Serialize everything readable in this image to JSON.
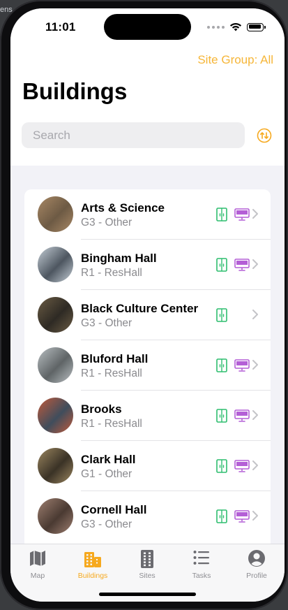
{
  "background_text": "ens",
  "status": {
    "time": "11:01"
  },
  "header": {
    "site_group": "Site Group: All",
    "title": "Buildings",
    "search_placeholder": "Search"
  },
  "buildings": [
    {
      "name": "Arts & Science",
      "sub": "G3 - Other",
      "has_door": true,
      "has_display": true,
      "photo": [
        "#6d5a44",
        "#a88865"
      ]
    },
    {
      "name": "Bingham Hall",
      "sub": "R1 - ResHall",
      "has_door": true,
      "has_display": true,
      "photo": [
        "#4d5660",
        "#c5ced6"
      ]
    },
    {
      "name": "Black Culture Center",
      "sub": "G3 - Other",
      "has_door": true,
      "has_display": false,
      "photo": [
        "#2e2a24",
        "#6b5c44"
      ]
    },
    {
      "name": "Bluford Hall",
      "sub": "R1 - ResHall",
      "has_door": true,
      "has_display": true,
      "photo": [
        "#5f6466",
        "#b9bfc2"
      ]
    },
    {
      "name": "Brooks",
      "sub": "R1 - ResHall",
      "has_door": true,
      "has_display": true,
      "photo": [
        "#3f4d5c",
        "#c25a3a"
      ]
    },
    {
      "name": "Clark Hall",
      "sub": "G1 - Other",
      "has_door": true,
      "has_display": true,
      "photo": [
        "#3a3226",
        "#9c8760"
      ]
    },
    {
      "name": "Cornell Hall",
      "sub": "G3 - Other",
      "has_door": true,
      "has_display": true,
      "photo": [
        "#4a3a32",
        "#9e7f70"
      ]
    }
  ],
  "tabs": [
    {
      "label": "Map",
      "icon": "map-icon",
      "active": false
    },
    {
      "label": "Buildings",
      "icon": "buildings-icon",
      "active": true
    },
    {
      "label": "Sites",
      "icon": "sites-icon",
      "active": false
    },
    {
      "label": "Tasks",
      "icon": "tasks-icon",
      "active": false
    },
    {
      "label": "Profile",
      "icon": "profile-icon",
      "active": false
    }
  ],
  "colors": {
    "accent": "#f6a91f",
    "door_icon": "#2dbd6e",
    "display_icon": "#b45fd6",
    "inactive_tab": "#8e8e93"
  }
}
